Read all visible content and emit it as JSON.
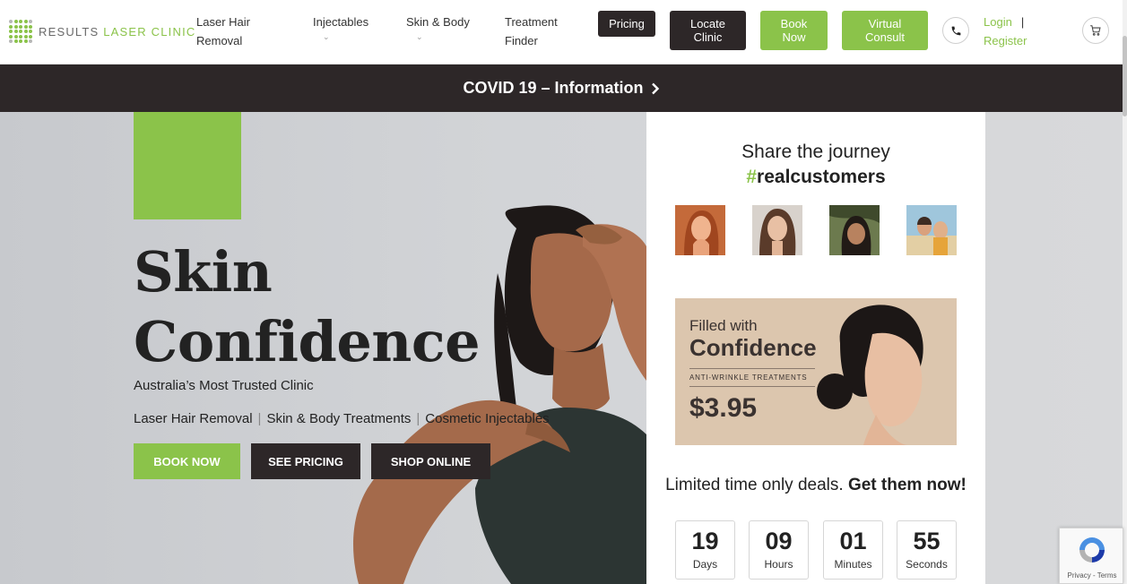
{
  "header": {
    "logo_text_1": "RESULTS",
    "logo_text_2": "LASER CLINIC",
    "nav": [
      {
        "label_1": "Laser Hair",
        "label_2": "Removal"
      },
      {
        "label_1": "Injectables",
        "chevron": "chevron-down-icon"
      },
      {
        "label_1": "Skin & Body",
        "chevron": "chevron-down-icon"
      },
      {
        "label_1": "Treatment",
        "label_2": "Finder"
      }
    ],
    "buttons": {
      "pricing": "Pricing",
      "locate_1": "Locate",
      "locate_2": "Clinic",
      "book_1": "Book",
      "book_2": "Now",
      "virtual_1": "Virtual",
      "virtual_2": "Consult"
    },
    "login": "Login",
    "separator": "|",
    "register": "Register",
    "icons": {
      "phone": "phone-icon",
      "cart": "cart-icon"
    }
  },
  "covid_banner": {
    "label": "COVID 19 – Information",
    "icon": "chevron-right-icon"
  },
  "hero": {
    "title_line1": "Skin",
    "title_line2": "Confidence",
    "subtitle": "Australia’s Most Trusted Clinic",
    "links": [
      "Laser Hair Removal",
      "Skin & Body Treatments",
      "Cosmetic Injectables"
    ],
    "link_separator": "|",
    "ctas": {
      "book": "BOOK NOW",
      "pricing": "SEE PRICING",
      "shop": "SHOP ONLINE"
    }
  },
  "panel": {
    "share_title": "Share the journey",
    "hashtag_symbol": "#",
    "hashtag_word": "realcustomers",
    "promo": {
      "line1": "Filled with",
      "line2": "Confidence",
      "line3": "ANTI-WRINKLE TREATMENTS",
      "price": "$3.95"
    },
    "deals_text": "Limited time only deals.",
    "deals_bold": "Get them now!",
    "countdown": [
      {
        "value": "19",
        "label": "Days"
      },
      {
        "value": "09",
        "label": "Hours"
      },
      {
        "value": "01",
        "label": "Minutes"
      },
      {
        "value": "55",
        "label": "Seconds"
      }
    ]
  },
  "recaptcha": {
    "privacy": "Privacy",
    "terms": "Terms",
    "separator": " - "
  },
  "colors": {
    "accent_green": "#8bc34a",
    "dark": "#2d2728"
  }
}
